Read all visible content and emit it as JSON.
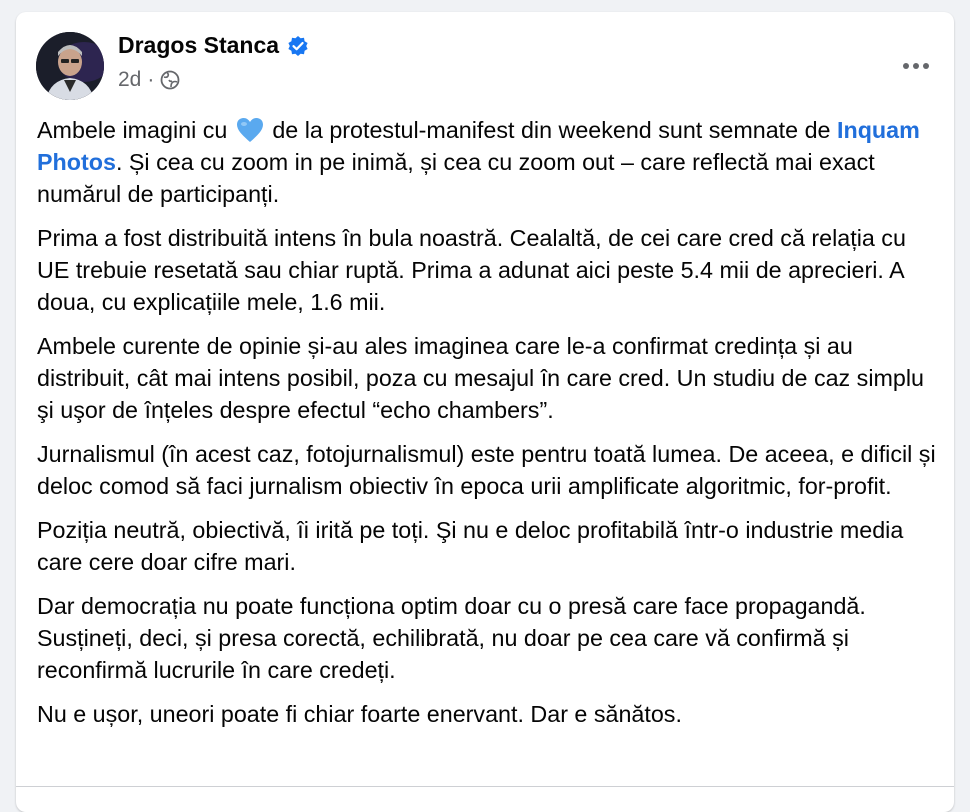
{
  "post": {
    "author": "Dragos Stanca",
    "time": "2d",
    "meta_separator": "·",
    "p1_a": "Ambele imagini cu",
    "p1_b": "de la protestul-manifest din weekend sunt semnate de",
    "p1_link": "Inquam Photos",
    "p1_c": ". Și cea cu zoom in pe inimă, și cea cu zoom out – care reflectă mai exact numărul de participanți.",
    "p2": "Prima a fost distribuită intens în bula noastră. Cealaltă, de cei care cred că relația cu UE trebuie resetată sau chiar ruptă. Prima a adunat aici peste 5.4 mii de aprecieri. A doua, cu explicațiile mele, 1.6 mii.",
    "p3": "Ambele curente de opinie și-au ales imaginea care le-a confirmat credința și au distribuit, cât mai intens posibil, poza cu mesajul în care cred. Un studiu de caz simplu şi uşor de înțeles despre efectul “echo chambers”.",
    "p4": "Jurnalismul (în acest caz, fotojurnalismul) este pentru toată lumea. De aceea, e dificil și deloc comod să faci jurnalism obiectiv în epoca urii amplificate algoritmic, for-profit.",
    "p5": "Poziția neutră, obiectivă, îi irită pe toți. Şi nu e deloc profitabilă într-o industrie media care cere doar cifre mari.",
    "p6": "Dar democrația nu poate funcționa optim doar cu o presă care face propagandă. Susțineți, deci, și presa corectă, echilibrată, nu doar pe cea care vă confirmă și reconfirmă lucrurile în care credeți.",
    "p7": "Nu e ușor, uneori poate fi chiar foarte enervant. Dar e sănătos."
  },
  "icons": {
    "verified": "verified-badge-icon",
    "audience": "globe-icon",
    "more": "more-options-icon",
    "heart": "blue-heart-emoji"
  },
  "colors": {
    "link": "#216fdb",
    "verified": "#1877f2",
    "heart": "#5aa9ef",
    "meta": "#65676b"
  }
}
